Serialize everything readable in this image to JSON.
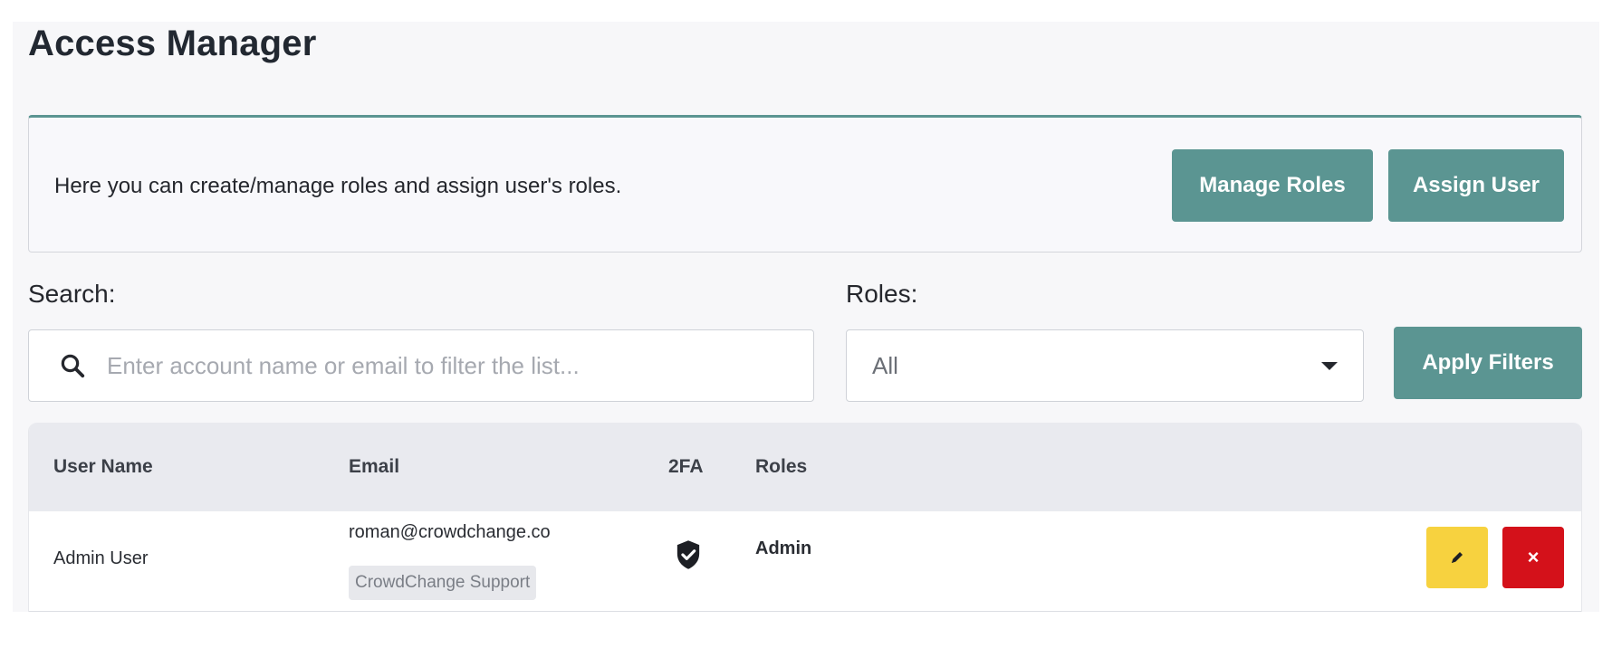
{
  "page": {
    "title": "Access Manager"
  },
  "info_card": {
    "description": "Here you can create/manage roles and assign user's roles.",
    "manage_roles_label": "Manage Roles",
    "assign_user_label": "Assign User",
    "accent_color": "#5b9592"
  },
  "filters": {
    "search_label": "Search:",
    "search_placeholder": "Enter account name or email to filter the list...",
    "search_value": "",
    "roles_label": "Roles:",
    "roles_selected": "All",
    "apply_label": "Apply Filters"
  },
  "table": {
    "columns": {
      "user_name": "User Name",
      "email": "Email",
      "twofa": "2FA",
      "roles": "Roles"
    },
    "rows": [
      {
        "user_name": "Admin User",
        "email": "roman@crowdchange.co",
        "org": "CrowdChange Support",
        "twofa_icon": "shield-check-icon",
        "role": "Admin",
        "edit_icon": "pencil-icon",
        "delete_icon": "close-icon",
        "delete_glyph": "×"
      }
    ]
  },
  "colors": {
    "teal": "#5b9592",
    "edit_yellow": "#f7d23f",
    "delete_red": "#d4111a",
    "header_gray": "#e9eaef"
  }
}
